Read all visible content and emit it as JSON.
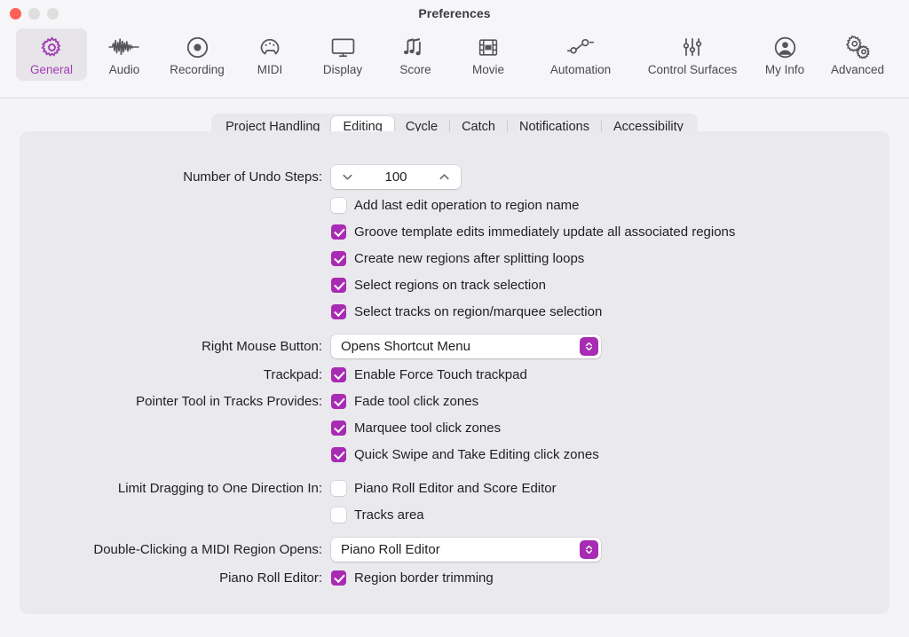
{
  "window": {
    "title": "Preferences",
    "traffic_lights": [
      "close",
      "minimize",
      "maximize"
    ]
  },
  "toolbar": {
    "items": [
      {
        "label": "General",
        "icon": "gear-icon",
        "selected": true
      },
      {
        "label": "Audio",
        "icon": "waveform-icon",
        "selected": false
      },
      {
        "label": "Recording",
        "icon": "record-circle-icon",
        "selected": false
      },
      {
        "label": "MIDI",
        "icon": "midi-connector-icon",
        "selected": false
      },
      {
        "label": "Display",
        "icon": "monitor-icon",
        "selected": false
      },
      {
        "label": "Score",
        "icon": "music-notes-icon",
        "selected": false
      },
      {
        "label": "Movie",
        "icon": "film-strip-icon",
        "selected": false
      },
      {
        "label": "Automation",
        "icon": "automation-nodes-icon",
        "selected": false
      },
      {
        "label": "Control Surfaces",
        "icon": "sliders-icon",
        "selected": false
      },
      {
        "label": "My Info",
        "icon": "person-circle-icon",
        "selected": false
      },
      {
        "label": "Advanced",
        "icon": "double-gear-icon",
        "selected": false
      }
    ]
  },
  "tabs": [
    {
      "label": "Project Handling",
      "selected": false
    },
    {
      "label": "Editing",
      "selected": true
    },
    {
      "label": "Cycle",
      "selected": false
    },
    {
      "label": "Catch",
      "selected": false
    },
    {
      "label": "Notifications",
      "selected": false
    },
    {
      "label": "Accessibility",
      "selected": false
    }
  ],
  "settings": {
    "undo_steps": {
      "label": "Number of Undo Steps:",
      "value": "100",
      "decrement_icon": "chevron-down-icon",
      "increment_icon": "chevron-up-icon"
    },
    "checkboxes_undo": [
      {
        "label": "Add last edit operation to region name",
        "checked": false
      },
      {
        "label": "Groove template edits immediately update all associated regions",
        "checked": true
      },
      {
        "label": "Create new regions after splitting loops",
        "checked": true
      },
      {
        "label": "Select regions on track selection",
        "checked": true
      },
      {
        "label": "Select tracks on region/marquee selection",
        "checked": true
      }
    ],
    "right_mouse_button": {
      "label": "Right Mouse Button:",
      "value": "Opens Shortcut Menu",
      "arrow_icon": "up-down-chevron-icon"
    },
    "trackpad": {
      "label": "Trackpad:",
      "checkbox": {
        "label": "Enable Force Touch trackpad",
        "checked": true
      }
    },
    "pointer_tool": {
      "label": "Pointer Tool in Tracks Provides:",
      "checkboxes": [
        {
          "label": "Fade tool click zones",
          "checked": true
        },
        {
          "label": "Marquee tool click zones",
          "checked": true
        },
        {
          "label": "Quick Swipe and Take Editing click zones",
          "checked": true
        }
      ]
    },
    "limit_dragging": {
      "label": "Limit Dragging to One Direction In:",
      "checkboxes": [
        {
          "label": "Piano Roll Editor and Score Editor",
          "checked": false
        },
        {
          "label": "Tracks area",
          "checked": false
        }
      ]
    },
    "double_click_midi": {
      "label": "Double-Clicking a MIDI Region Opens:",
      "value": "Piano Roll Editor",
      "arrow_icon": "up-down-chevron-icon"
    },
    "piano_roll_editor": {
      "label": "Piano Roll Editor:",
      "checkbox": {
        "label": "Region border trimming",
        "checked": true
      }
    }
  },
  "colors": {
    "accent": "#a82bb3",
    "selected_tab_text": "#a23fb5",
    "window_bg": "#f4f3f6",
    "panel_bg": "#eae9ed",
    "close_button": "#ff6159"
  }
}
